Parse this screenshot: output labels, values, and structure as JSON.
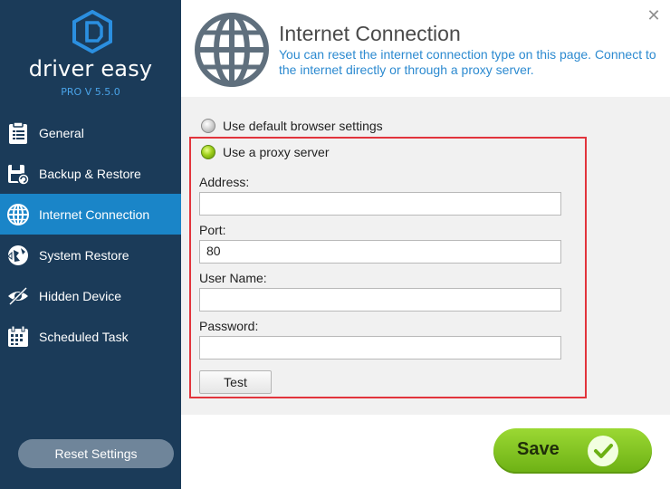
{
  "sidebar": {
    "brand": "driver easy",
    "version": "PRO V 5.5.0",
    "items": [
      {
        "label": "General",
        "icon": "clipboard-icon"
      },
      {
        "label": "Backup & Restore",
        "icon": "backup-restore-icon"
      },
      {
        "label": "Internet Connection",
        "icon": "globe-icon",
        "active": true
      },
      {
        "label": "System Restore",
        "icon": "system-restore-icon"
      },
      {
        "label": "Hidden Device",
        "icon": "eye-slash-icon"
      },
      {
        "label": "Scheduled Task",
        "icon": "calendar-icon"
      }
    ],
    "reset_label": "Reset Settings"
  },
  "header": {
    "title": "Internet Connection",
    "description": "You can reset the internet connection type on this page. Connect to the internet directly or through a proxy server."
  },
  "options": {
    "default_label": "Use default browser settings",
    "proxy_label": "Use a proxy server",
    "selected": "proxy"
  },
  "proxy": {
    "address_label": "Address:",
    "address_value": "",
    "port_label": "Port:",
    "port_value": "80",
    "username_label": "User Name:",
    "username_value": "",
    "password_label": "Password:",
    "password_value": "",
    "test_label": "Test"
  },
  "footer": {
    "save_label": "Save"
  },
  "colors": {
    "sidebar_bg": "#1b3b59",
    "active_item": "#1a85c8",
    "accent_blue": "#2c8ad0",
    "highlight_border": "#e2343c",
    "save_green": "#7cc11f"
  }
}
